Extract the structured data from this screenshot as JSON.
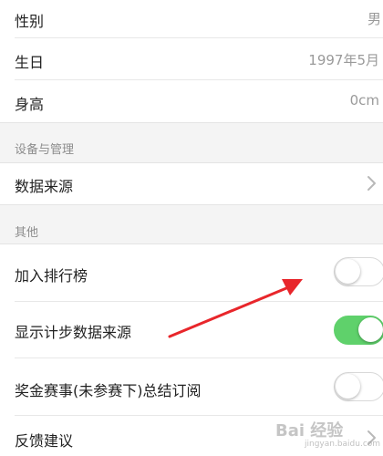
{
  "profile": {
    "gender": {
      "label": "性别",
      "value": "男"
    },
    "birthday": {
      "label": "生日",
      "value": "1997年5月"
    },
    "height": {
      "label": "身高",
      "value": "0cm"
    }
  },
  "devices_section": {
    "title": "设备与管理",
    "data_source": {
      "label": "数据来源",
      "icon": "chevron-right-icon"
    }
  },
  "other_section": {
    "title": "其他",
    "join_leaderboard": {
      "label": "加入排行榜",
      "enabled": false
    },
    "show_step_source": {
      "label": "显示计步数据来源",
      "enabled": true
    },
    "bonus_subscription": {
      "label": "奖金赛事(未参赛下)总结订阅",
      "enabled": false
    },
    "feedback": {
      "label": "反馈建议",
      "icon": "chevron-right-icon"
    }
  },
  "annotation": {
    "arrow_color": "#e8262b"
  },
  "colors": {
    "toggle_on": "#5fd16b",
    "toggle_off_border": "#d9d9d9",
    "secondary_text": "#9a9a9a"
  },
  "watermark": {
    "text": "Bai 经验",
    "sub": "jingyan.baidu.com"
  }
}
